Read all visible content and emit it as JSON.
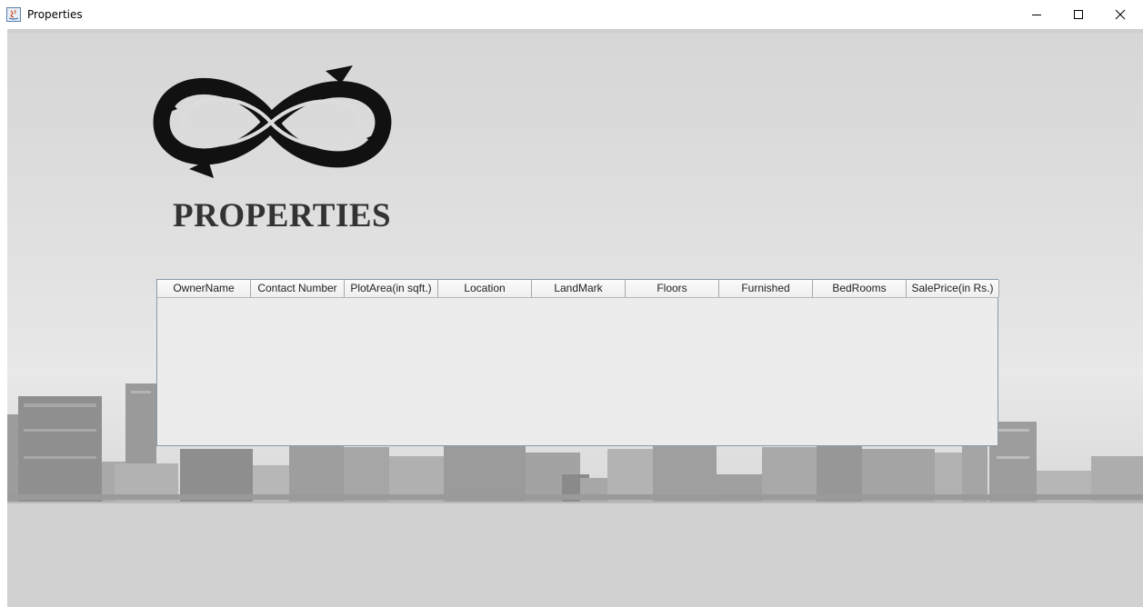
{
  "window": {
    "title": "Properties",
    "controls": [
      "minimize-icon",
      "maximize-icon",
      "close-icon"
    ]
  },
  "brand": {
    "name": "PROPERTIES",
    "logo_icon": "infinity-logo-icon"
  },
  "table": {
    "columns": [
      "OwnerName",
      "Contact Number",
      "PlotArea(in sqft.)",
      "Location",
      "LandMark",
      "Floors",
      "Furnished",
      "BedRooms",
      "SalePrice(in Rs.)"
    ],
    "rows": []
  },
  "colors": {
    "brand_text": "#333333",
    "table_border": "#8a9aa8",
    "background": "#dedede"
  }
}
